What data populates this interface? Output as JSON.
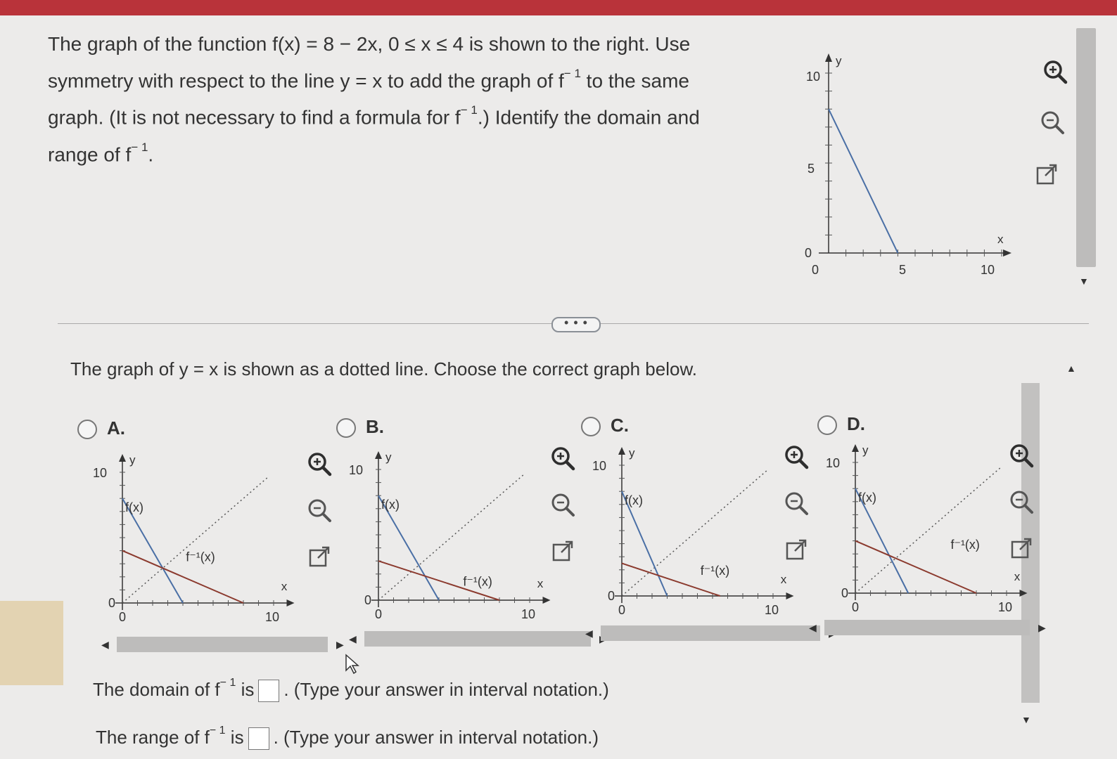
{
  "question": {
    "line1_a": "The graph of the function f(x) = 8 − 2x, 0 ≤ x ≤ 4 is shown to the right. Use",
    "line2_a": "symmetry with respect to the line y = x to add the graph of f",
    "line2_sup": "− 1",
    "line2_b": " to the same",
    "line3_a": "graph. (It is not necessary to find a formula for f",
    "line3_sup": "− 1",
    "line3_b": ".) Identify the domain and",
    "line4_a": "range of f",
    "line4_sup": "− 1",
    "line4_b": "."
  },
  "main_graph": {
    "y_label": "y",
    "x_label": "x",
    "y_ticks": [
      "10",
      "5",
      "0"
    ],
    "x_ticks": [
      "0",
      "5",
      "10"
    ],
    "f_points": [
      [
        0,
        8
      ],
      [
        4,
        0
      ]
    ]
  },
  "divider_button": "• • •",
  "instruction": "The graph of y = x is shown as a dotted line. Choose the correct graph below.",
  "options": [
    {
      "letter": "A.",
      "f_label": "f(x)",
      "finv_label": "f⁻¹(x)",
      "y_tick": "10",
      "zero": "0",
      "x_zero": "0",
      "x_ten": "10",
      "y": "y",
      "x": "x"
    },
    {
      "letter": "B.",
      "f_label": "f(x)",
      "finv_label": "f⁻¹(x)",
      "y_tick": "10",
      "zero": "0",
      "x_zero": "0",
      "x_ten": "10",
      "y": "y",
      "x": "x"
    },
    {
      "letter": "C.",
      "f_label": "f(x)",
      "finv_label": "f⁻¹(x)",
      "y_tick": "10",
      "zero": "0",
      "x_zero": "0",
      "x_ten": "10",
      "y": "y",
      "x": "x"
    },
    {
      "letter": "D.",
      "f_label": "f(x)",
      "finv_label": "f⁻¹(x)",
      "y_tick": "10",
      "zero": "0",
      "x_zero": "0",
      "x_ten": "10",
      "y": "y",
      "x": "x"
    }
  ],
  "answers": {
    "domain_a": "The domain of f",
    "domain_sup": "− 1",
    "domain_b": " is",
    "domain_c": ". (Type your answer in interval notation.)",
    "range_a": "The range of f",
    "range_sup": "− 1",
    "range_b": " is",
    "range_c": ". (Type your answer in interval notation.)"
  },
  "colors": {
    "f_line": "#4a6fa5",
    "finv_line": "#8b3a2e",
    "accent_bar": "#b9333a",
    "icon_dark": "#2e2e2e"
  },
  "icons": [
    "zoom-in-icon",
    "zoom-out-icon",
    "open-external-icon"
  ]
}
